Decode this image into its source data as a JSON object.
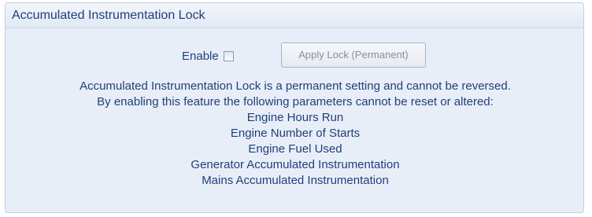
{
  "panel": {
    "title": "Accumulated Instrumentation Lock"
  },
  "enable": {
    "label": "Enable",
    "checked": false
  },
  "apply_button": {
    "label": "Apply Lock (Permanent)",
    "enabled": false
  },
  "info": {
    "lines": [
      "Accumulated Instrumentation Lock is a permanent setting and cannot be reversed.",
      "By enabling this feature the following parameters cannot be reset or altered:",
      "Engine Hours Run",
      "Engine Number of Starts",
      "Engine Fuel Used",
      "Generator Accumulated Instrumentation",
      "Mains Accumulated Instrumentation"
    ]
  }
}
